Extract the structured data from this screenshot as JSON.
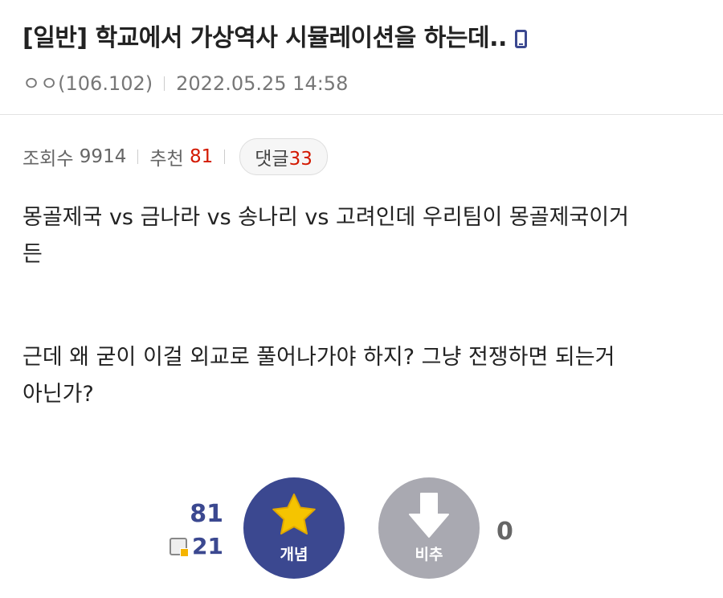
{
  "post": {
    "title": "[일반] 학교에서 가상역사 시뮬레이션을 하는데..",
    "author": "ㅇㅇ(106.102)",
    "date": "2022.05.25 14:58"
  },
  "stats": {
    "views_label": "조회수",
    "views": "9914",
    "recommend_label": "추천",
    "recommend": "81",
    "comments_label": "댓글",
    "comments": "33"
  },
  "body": {
    "paragraph1_line1": "몽골제국 vs 금나라 vs 송나리 vs 고려인데 우리팀이 몽골제국이거",
    "paragraph1_line2": "든",
    "paragraph2_line1": "근데 왜 굳이 이걸 외교로 풀어나가야 하지? 그냥 전쟁하면 되는거",
    "paragraph2_line2": "아닌가?"
  },
  "votes": {
    "recommend_count": "81",
    "fixed_count": "21",
    "upvote_label": "개념",
    "downvote_label": "비추",
    "downvote_count": "0"
  },
  "icons": {
    "mobile": "mobile-icon",
    "star": "star-icon",
    "down_arrow": "down-arrow-icon",
    "fixed": "fixed-user-icon"
  },
  "colors": {
    "accent": "#3b4890",
    "star": "#f5c400",
    "red": "#d31900",
    "down_button": "#a9a9b1"
  }
}
